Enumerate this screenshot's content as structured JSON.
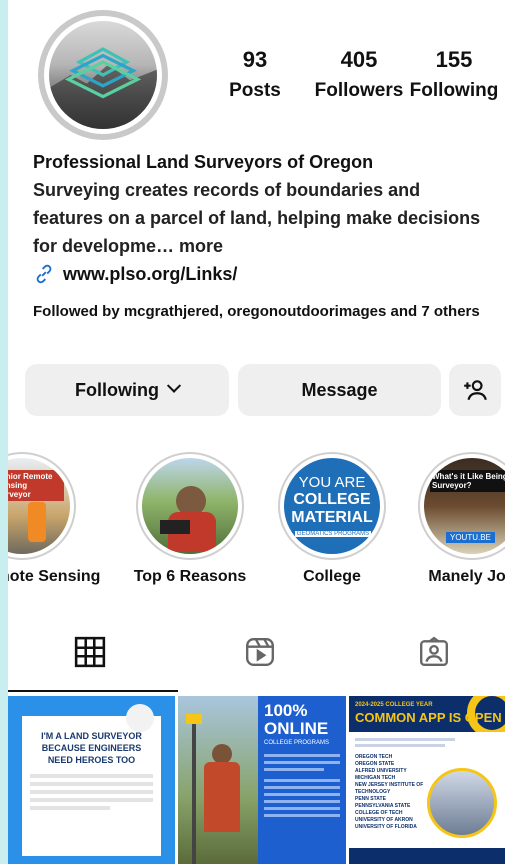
{
  "profile": {
    "name": "Professional Land Surveyors of Oregon",
    "bio": "Surveying creates records of boundaries and features on a parcel of land, helping make decisions for developme… more",
    "link": "www.plso.org/Links/"
  },
  "stats": [
    {
      "value": "93",
      "label": "Posts"
    },
    {
      "value": "405",
      "label": "Followers"
    },
    {
      "value": "155",
      "label": "Following"
    }
  ],
  "followed_by": "Followed by mcgrathjered, oregonoutdoorimages and 7 others",
  "buttons": {
    "following": "Following",
    "message": "Message"
  },
  "highlights": [
    {
      "label": "mote Sensing",
      "thumb_text": "Senior Remote Sensing Surveyor"
    },
    {
      "label": "Top 6 Reasons"
    },
    {
      "label": "College",
      "line1": "YOU ARE",
      "line2": "COLLEGE",
      "line3": "MATERIAL",
      "line4": "GEOMATICS PROGRAMS"
    },
    {
      "label": "Manely Job",
      "thumb_text": "What's it Like Being a Surveyor?",
      "tag": "YOUTU.BE"
    }
  ],
  "posts": [
    {
      "title": "I'M A LAND SURVEYOR BECAUSE ENGINEERS NEED HEROES TOO"
    },
    {
      "title": "100% ONLINE",
      "subtitle": "COLLEGE PROGRAMS"
    },
    {
      "kicker": "2024-2025 COLLEGE YEAR",
      "title": "COMMON APP IS OPEN",
      "schools": [
        "OREGON TECH",
        "OREGON STATE",
        "ALFRED UNIVERSITY",
        "MICHIGAN TECH",
        "NEW JERSEY INSTITUTE OF TECHNOLOGY",
        "PENN STATE",
        "PENNSYLVANIA STATE COLLEGE OF TECH",
        "UNIVERSITY OF AKRON",
        "UNIVERSITY OF FLORIDA"
      ]
    }
  ],
  "colors": {
    "accent_blue": "#1a6fd1",
    "post_blue": "#2a7de1",
    "navy": "#0c2f6b",
    "yellow": "#f5c518"
  }
}
